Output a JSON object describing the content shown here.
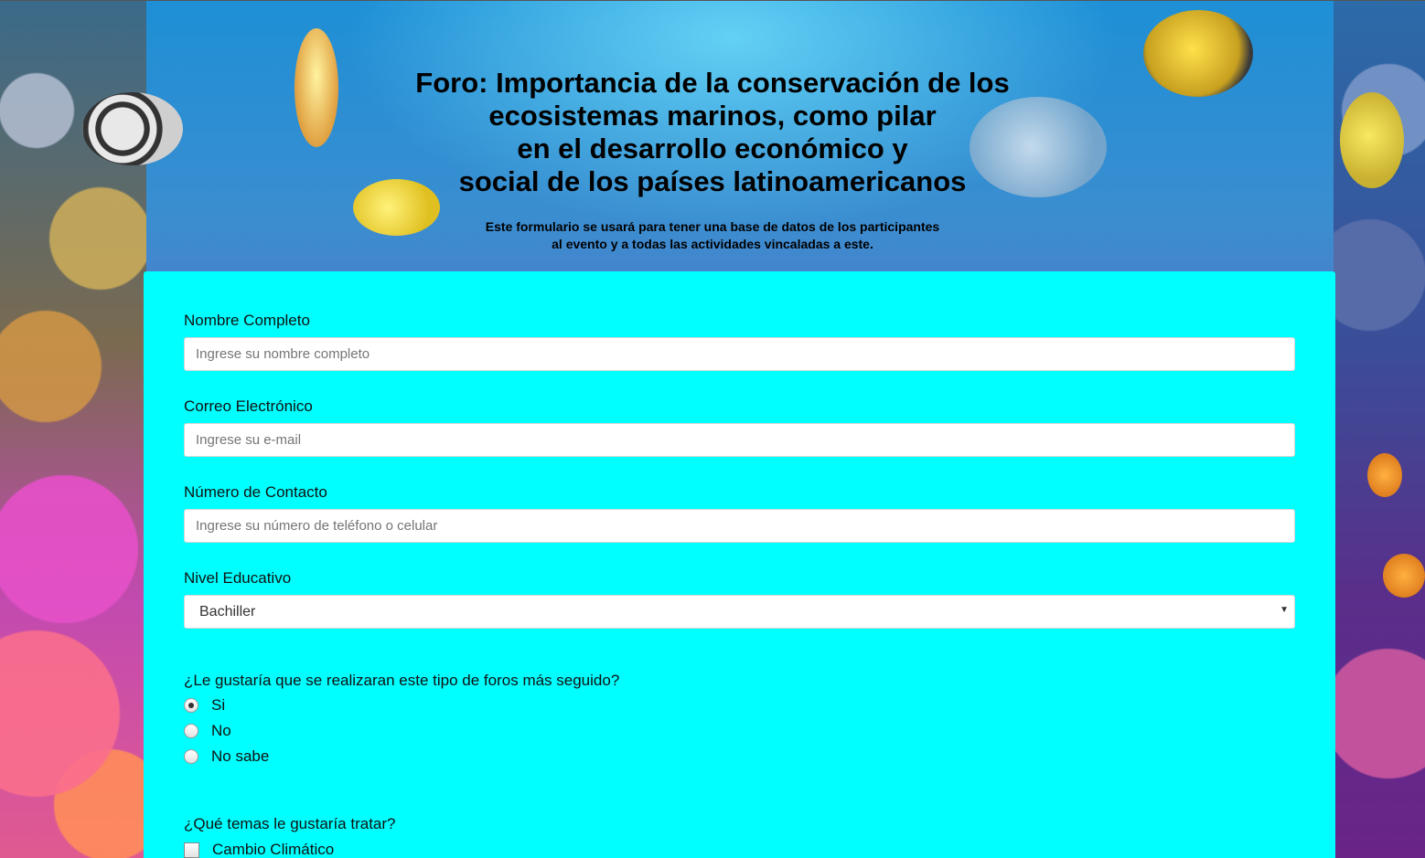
{
  "header": {
    "title_lines": [
      "Foro: Importancia de la conservación de los",
      "ecosistemas marinos, como pilar",
      "en el desarrollo económico y",
      "social de los países latinoamericanos"
    ],
    "subtitle_lines": [
      "Este formulario se usará para tener una base de datos de los participantes",
      "al evento y a todas las actividades vincaladas a este."
    ]
  },
  "form": {
    "name": {
      "label": "Nombre Completo",
      "placeholder": "Ingrese su nombre completo",
      "value": ""
    },
    "email": {
      "label": "Correo Electrónico",
      "placeholder": "Ingrese su e-mail",
      "value": ""
    },
    "phone": {
      "label": "Número de Contacto",
      "placeholder": "Ingrese su número de teléfono o celular",
      "value": ""
    },
    "education": {
      "label": "Nivel Educativo",
      "selected": "Bachiller",
      "arrow_icon": "chevron-down-icon"
    },
    "frequency_question": {
      "label": "¿Le gustaría que se realizaran este tipo de foros más seguido?",
      "options": [
        "Si",
        "No",
        "No sabe"
      ],
      "selected": "Si"
    },
    "topics_question": {
      "label": "¿Qué temas le gustaría tratar?",
      "options": [
        "Cambio Climático"
      ]
    }
  },
  "colors": {
    "panel_background": "#00ffff",
    "input_background": "#ffffff"
  }
}
